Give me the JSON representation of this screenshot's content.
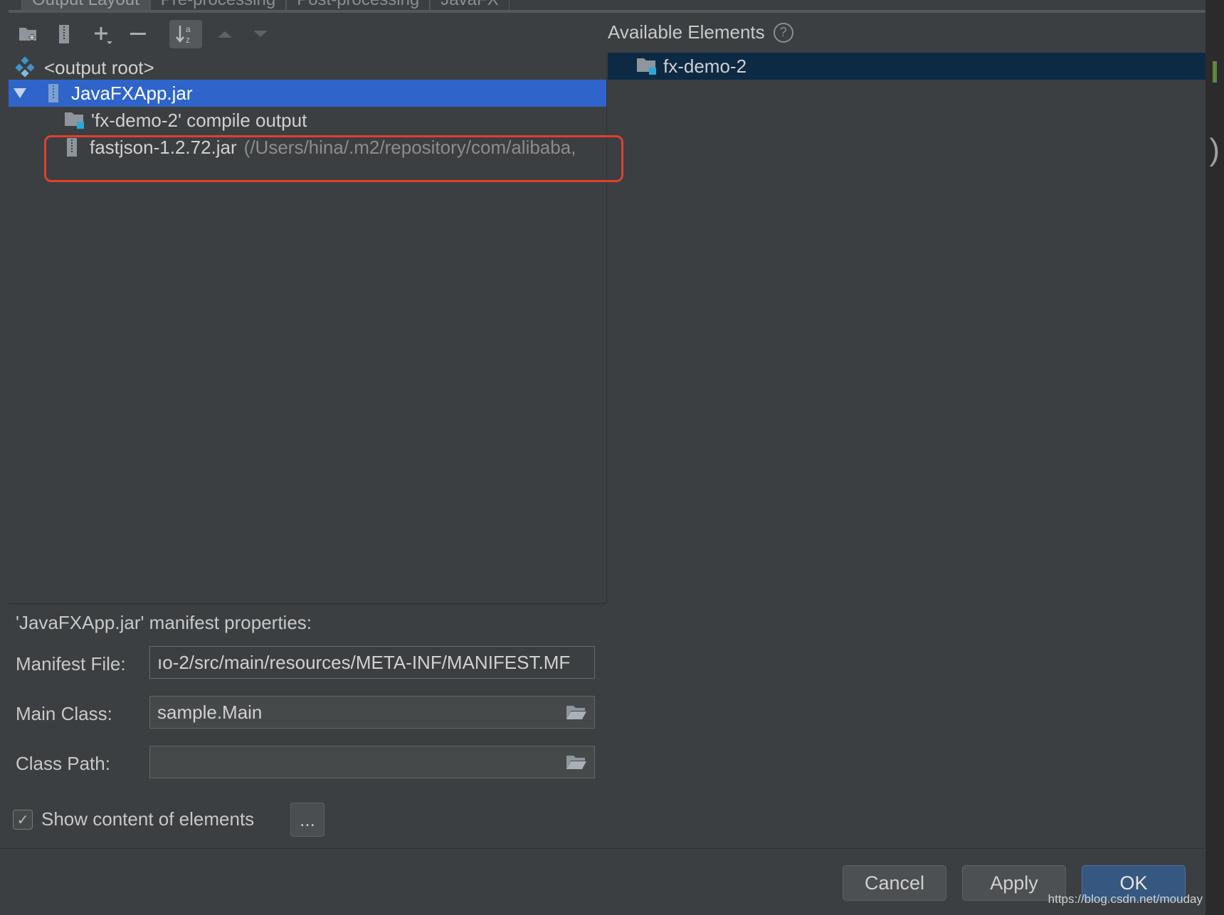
{
  "tabs": [
    "Output Layout",
    "Pre-processing",
    "Post-processing",
    "JavaFX"
  ],
  "tree": {
    "root": "<output root>",
    "jar": "JavaFXApp.jar",
    "compile_output": "'fx-demo-2' compile output",
    "lib_name": "fastjson-1.2.72.jar",
    "lib_path": "(/Users/hina/.m2/repository/com/alibaba,"
  },
  "available": {
    "title": "Available Elements",
    "help": "?",
    "items": [
      "fx-demo-2"
    ]
  },
  "manifest": {
    "heading": "'JavaFXApp.jar' manifest properties:",
    "manifest_label": "Manifest File:",
    "manifest_value": "ıo-2/src/main/resources/META-INF/MANIFEST.MF",
    "main_label": "Main Class:",
    "main_value": "sample.Main",
    "classpath_label": "Class Path:",
    "classpath_value": ""
  },
  "options": {
    "show_content_label": "Show content of elements",
    "show_content_checked": true,
    "dots_label": "..."
  },
  "buttons": {
    "cancel": "Cancel",
    "apply": "Apply",
    "ok": "OK"
  },
  "watermark": "https://blog.csdn.net/mouday",
  "colors": {
    "background": "#3c3f41",
    "selection": "#2f65ca",
    "available_selection": "#0d2a45",
    "highlight_box": "#e0402f",
    "ok_button": "#365880"
  }
}
